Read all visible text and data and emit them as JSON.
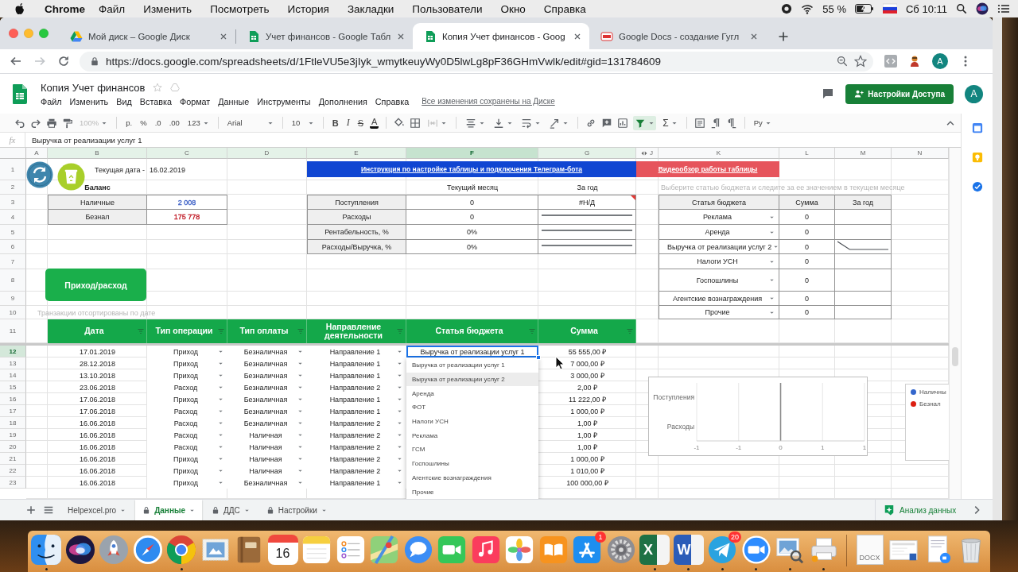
{
  "menu_bar": {
    "app": "Chrome",
    "menus": [
      "Файл",
      "Изменить",
      "Посмотреть",
      "История",
      "Закладки",
      "Пользователи",
      "Окно",
      "Справка"
    ],
    "battery": "55 %",
    "clock": "Сб 10:11"
  },
  "browser": {
    "tabs": [
      {
        "title": "Мой диск – Google Диск",
        "kind": "drive",
        "selected": false
      },
      {
        "title": "Учет финансов - Google Табл",
        "kind": "sheets",
        "selected": false
      },
      {
        "title": "Копия Учет финансов - Goog",
        "kind": "sheets",
        "selected": true
      },
      {
        "title": "Google Docs - создание Гугл",
        "kind": "docs",
        "selected": false
      }
    ],
    "url": "https://docs.google.com/spreadsheets/d/1FtleVU5e3jIyk_wmytkeuyWy0D5lwLg8pF36GHmVwlk/edit#gid=131784609",
    "profile": "A"
  },
  "document": {
    "title": "Копия Учет финансов",
    "menus": [
      "Файл",
      "Изменить",
      "Вид",
      "Вставка",
      "Формат",
      "Данные",
      "Инструменты",
      "Дополнения",
      "Справка"
    ],
    "save_status": "Все изменения сохранены на Диске",
    "share_button": "Настройки Доступа",
    "account": "A"
  },
  "toolbar": {
    "zoom": "100%",
    "zoom_disabled": true,
    "currency": "р.",
    "percent": "%",
    "fewer_decimals": ".0",
    "more_decimals": ".00",
    "number_formats": "123",
    "font": "Arial",
    "font_size": "10",
    "bold": "B",
    "italic": "I",
    "strikethrough": "S",
    "text_color": "A",
    "merge_disabled": true,
    "filter_on": true,
    "functions": "Σ",
    "input_tools": "Ру"
  },
  "formula_bar": {
    "label": "fx",
    "value": "Выручка от реализации услуг 1"
  },
  "sheet": {
    "columns": [
      {
        "label": "A",
        "filtered": false,
        "selected": false,
        "hidden_before": false
      },
      {
        "label": "B",
        "filtered": true,
        "selected": false,
        "hidden_before": false
      },
      {
        "label": "C",
        "filtered": true,
        "selected": false,
        "hidden_before": false
      },
      {
        "label": "D",
        "filtered": true,
        "selected": false,
        "hidden_before": false
      },
      {
        "label": "E",
        "filtered": true,
        "selected": false,
        "hidden_before": false
      },
      {
        "label": "F",
        "filtered": true,
        "selected": true,
        "hidden_before": false
      },
      {
        "label": "G",
        "filtered": true,
        "selected": false,
        "hidden_before": false
      },
      {
        "label": "J",
        "filtered": false,
        "selected": false,
        "hidden_before": true
      },
      {
        "label": "K",
        "filtered": false,
        "selected": false,
        "hidden_before": false
      },
      {
        "label": "L",
        "filtered": false,
        "selected": false,
        "hidden_before": false
      },
      {
        "label": "M",
        "filtered": false,
        "selected": false,
        "hidden_before": false
      },
      {
        "label": "N",
        "filtered": false,
        "selected": false,
        "hidden_before": false
      }
    ],
    "rows": [
      {
        "label": "1",
        "selected": false
      },
      {
        "label": "2",
        "selected": false
      },
      {
        "label": "3",
        "selected": false
      },
      {
        "label": "4",
        "selected": false
      },
      {
        "label": "5",
        "selected": false
      },
      {
        "label": "6",
        "selected": false
      },
      {
        "label": "7",
        "selected": false
      },
      {
        "label": "8",
        "selected": false
      },
      {
        "label": "9",
        "selected": false
      },
      {
        "label": "10",
        "selected": false
      },
      {
        "label": "11",
        "selected": false
      },
      {
        "label": "12",
        "selected": true
      },
      {
        "label": "13",
        "selected": false
      },
      {
        "label": "14",
        "selected": false
      },
      {
        "label": "15",
        "selected": false
      },
      {
        "label": "16",
        "selected": false
      },
      {
        "label": "17",
        "selected": false
      },
      {
        "label": "18",
        "selected": false
      },
      {
        "label": "19",
        "selected": false
      },
      {
        "label": "20",
        "selected": false
      },
      {
        "label": "21",
        "selected": false
      },
      {
        "label": "22",
        "selected": false
      },
      {
        "label": "23",
        "selected": false
      }
    ],
    "date_label": "Текущая дата -",
    "date": "16.02.2019",
    "balance": {
      "title": "Баланс",
      "rows": [
        {
          "label": "Наличные",
          "value": "2 008",
          "color": "#3b5fc6"
        },
        {
          "label": "Безнал",
          "value": "175 778",
          "color": "#c2202b"
        }
      ]
    },
    "links": [
      {
        "text": "Инструкция по настройке таблицы и подключения Телеграм-бота",
        "color": "#1046d2"
      },
      {
        "text": "Видеообзор работы таблицы",
        "color": "#e6545c"
      }
    ],
    "summary": {
      "columns": [
        "Текущий месяц",
        "За год"
      ],
      "rows": [
        {
          "label": "Поступления",
          "month": "0",
          "kind": "text",
          "year": "#Н/Д",
          "error": true
        },
        {
          "label": "Расходы",
          "month": "0",
          "kind": "sparkline",
          "error": false
        },
        {
          "label": "Рентабельность, %",
          "month": "0%",
          "kind": "sparkline",
          "error": false
        },
        {
          "label": "Расходы/Выручка, %",
          "month": "0%",
          "kind": "sparkline",
          "error": false
        }
      ]
    },
    "budget": {
      "hint": "Выберите статью бюджета и следите за ее значением в текущем месяце",
      "columns": [
        "Статья бюджета",
        "Сумма",
        "За год"
      ],
      "rows": [
        {
          "item": "Реклама",
          "sum": "0",
          "trend": false
        },
        {
          "item": "Аренда",
          "sum": "0",
          "trend": false
        },
        {
          "item": "Выручка от реализации услуг 2",
          "sum": "0",
          "trend": true
        },
        {
          "item": "Налоги УСН",
          "sum": "0",
          "trend": false
        },
        {
          "item": "Госпошлины",
          "sum": "0",
          "trend": false
        },
        {
          "item": "Агентские вознаграждения",
          "sum": "0",
          "trend": false
        },
        {
          "item": "Прочие",
          "sum": "0",
          "trend": false
        }
      ]
    },
    "add_button": "Приход/расход",
    "sort_note": "Транзакции отсортированы по дате",
    "transactions": {
      "columns": [
        "Дата",
        "Тип операции",
        "Тип оплаты",
        "Направление деятельности",
        "Статья бюджета",
        "Сумма"
      ],
      "rows": [
        {
          "date": "17.01.2019",
          "operation": "Приход",
          "payment": "Безналичная",
          "direction": "Направление 1",
          "item": "Выручка от реализации услуг 1",
          "sum": "55 555,00 ₽"
        },
        {
          "date": "28.12.2018",
          "operation": "Приход",
          "payment": "Безналичная",
          "direction": "Направление 1",
          "sum": "7 000,00 ₽"
        },
        {
          "date": "13.10.2018",
          "operation": "Приход",
          "payment": "Безналичная",
          "direction": "Направление 1",
          "sum": "3 000,00 ₽"
        },
        {
          "date": "23.06.2018",
          "operation": "Расход",
          "payment": "Безналичная",
          "direction": "Направление 2",
          "sum": "2,00 ₽"
        },
        {
          "date": "17.06.2018",
          "operation": "Приход",
          "payment": "Безналичная",
          "direction": "Направление 1",
          "sum": "11 222,00 ₽"
        },
        {
          "date": "17.06.2018",
          "operation": "Расход",
          "payment": "Безналичная",
          "direction": "Направление 1",
          "sum": "1 000,00 ₽"
        },
        {
          "date": "16.06.2018",
          "operation": "Расход",
          "payment": "Безналичная",
          "direction": "Направление 2",
          "sum": "1,00 ₽"
        },
        {
          "date": "16.06.2018",
          "operation": "Расход",
          "payment": "Наличная",
          "direction": "Направление 2",
          "sum": "1,00 ₽"
        },
        {
          "date": "16.06.2018",
          "operation": "Расход",
          "payment": "Наличная",
          "direction": "Направление 2",
          "sum": "1,00 ₽"
        },
        {
          "date": "16.06.2018",
          "operation": "Приход",
          "payment": "Наличная",
          "direction": "Направление 2",
          "sum": "1 000,00 ₽"
        },
        {
          "date": "16.06.2018",
          "operation": "Приход",
          "payment": "Наличная",
          "direction": "Направление 2",
          "sum": "1 010,00 ₽"
        },
        {
          "date": "16.06.2018",
          "operation": "Приход",
          "payment": "Безналичная",
          "direction": "Направление 1",
          "sum": "100 000,00 ₽"
        }
      ]
    },
    "dropdown": [
      {
        "label": "Выручка от реализации услуг 1",
        "selected": false
      },
      {
        "label": "Выручка от реализации услуг 2",
        "selected": true
      },
      {
        "label": "Аренда",
        "selected": false
      },
      {
        "label": "ФОТ",
        "selected": false
      },
      {
        "label": "Налоги УСН",
        "selected": false
      },
      {
        "label": "Реклама",
        "selected": false
      },
      {
        "label": "ГСМ",
        "selected": false
      },
      {
        "label": "Госпошлины",
        "selected": false
      },
      {
        "label": "Агентские вознаграждения",
        "selected": false
      },
      {
        "label": "Прочие",
        "selected": false
      }
    ],
    "chart": {
      "chart_data": {
        "type": "bar",
        "orientation": "horizontal",
        "categories": [
          "Поступления",
          "Расходы"
        ],
        "series": [
          {
            "name": "Наличны",
            "color": "#3366cc",
            "values": [
              0,
              0
            ]
          },
          {
            "name": "Безнал",
            "color": "#dc1f12",
            "values": [
              0,
              0
            ]
          }
        ],
        "xlim": [
          -1,
          1
        ],
        "xticks": [
          {
            "value": -1,
            "label": "-1"
          },
          {
            "value": -0.5,
            "label": "-1"
          },
          {
            "value": 0,
            "label": "0"
          },
          {
            "value": 0.5,
            "label": "1"
          },
          {
            "value": 1,
            "label": "1"
          }
        ]
      }
    }
  },
  "sheet_tabs": [
    {
      "label": "Helpexcel.pro",
      "locked": false,
      "selected": false
    },
    {
      "label": "Данные",
      "locked": true,
      "selected": true
    },
    {
      "label": "ДДС",
      "locked": true,
      "selected": false
    },
    {
      "label": "Настройки",
      "locked": true,
      "selected": false
    }
  ],
  "explore": "Анализ данных",
  "dock": {
    "apps": [
      {
        "kind": "finder",
        "running": true
      },
      {
        "kind": "siri",
        "running": false
      },
      {
        "kind": "launchpad",
        "running": false
      },
      {
        "kind": "safari",
        "running": false
      },
      {
        "kind": "chrome",
        "running": true
      },
      {
        "kind": "mail",
        "running": false
      },
      {
        "kind": "notebook",
        "running": false
      },
      {
        "kind": "calendar",
        "day": "16",
        "running": false
      },
      {
        "kind": "notes",
        "running": false
      },
      {
        "kind": "reminders",
        "running": false
      },
      {
        "kind": "maps",
        "running": false
      },
      {
        "kind": "messages",
        "running": false
      },
      {
        "kind": "facetime",
        "running": false
      },
      {
        "kind": "music",
        "running": false
      },
      {
        "kind": "photos",
        "running": false
      },
      {
        "kind": "books",
        "running": false
      },
      {
        "kind": "appstore",
        "badge": "1",
        "running": false
      },
      {
        "kind": "settings",
        "running": false
      },
      {
        "kind": "excel",
        "letter": "X",
        "running": true
      },
      {
        "kind": "word",
        "letter": "W",
        "running": true
      },
      {
        "kind": "telegram",
        "badge": "20",
        "running": true
      },
      {
        "kind": "zoom",
        "running": true
      },
      {
        "kind": "preview",
        "running": true
      },
      {
        "kind": "printer",
        "running": true
      }
    ],
    "documents": [
      {
        "kind": "docx",
        "caption": "DOCX"
      },
      {
        "kind": "screenshot"
      },
      {
        "kind": "video_doc"
      },
      {
        "kind": "trash"
      }
    ]
  }
}
